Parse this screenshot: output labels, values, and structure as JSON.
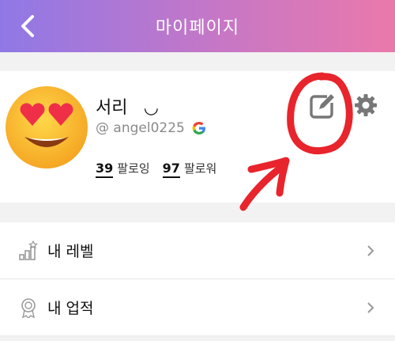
{
  "header": {
    "title": "마이페이지",
    "back_icon": "chevron-left-icon",
    "gradient": [
      "#8f78e6",
      "#ea79ab"
    ]
  },
  "profile": {
    "avatar_icon": "heart-eyes-emoji",
    "nickname": "서리ㅤ◡ㅤ",
    "handle": "@ angel0225",
    "provider_icon": "google-icon",
    "following_count": "39",
    "following_label": "팔로잉",
    "followers_count": "97",
    "followers_label": "팔로워",
    "edit_icon": "edit-icon",
    "settings_icon": "gear-icon"
  },
  "annotation": {
    "color": "#e8242c",
    "shapes": [
      "circle-around-edit-icon",
      "arrow-pointing-to-edit-icon"
    ]
  },
  "menu": [
    {
      "label": "내 레벨",
      "icon": "level-bars-icon"
    },
    {
      "label": "내 업적",
      "icon": "achievement-medal-icon"
    }
  ]
}
